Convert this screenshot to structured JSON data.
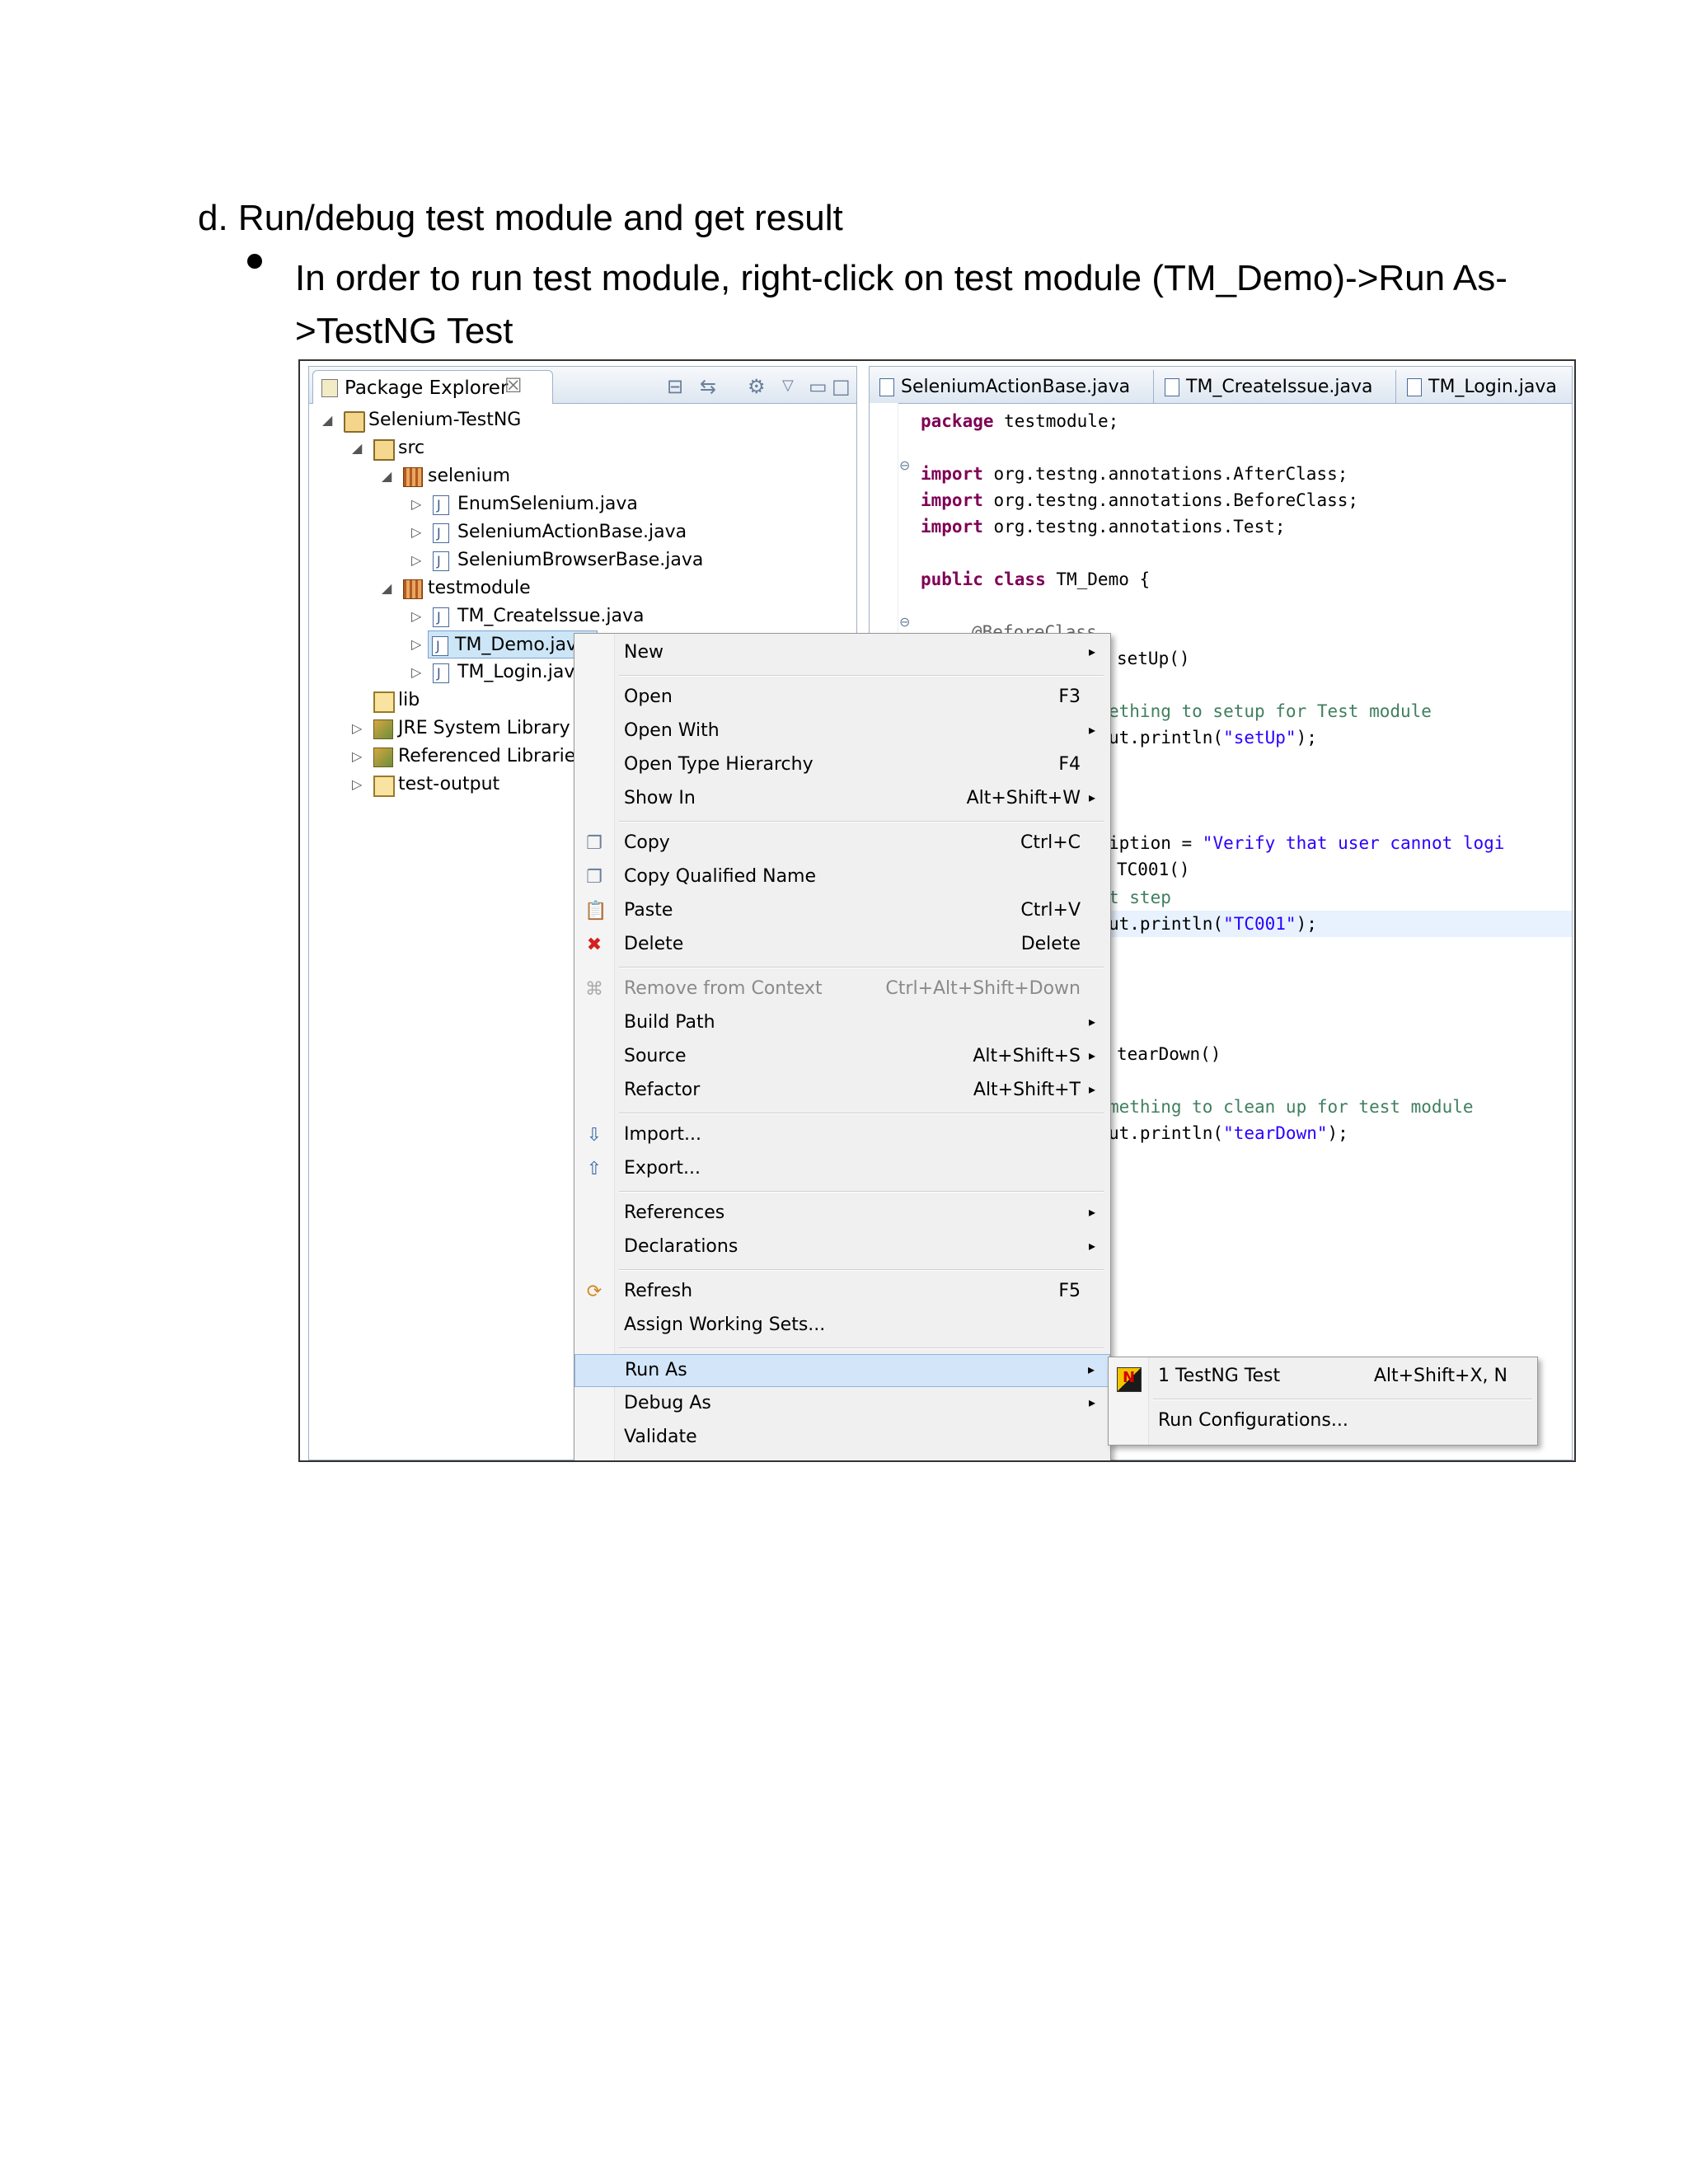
{
  "document": {
    "heading": "d.  Run/debug test module and get result",
    "bullet": "In order to run test module, right-click on test module (TM_Demo)->Run As->TestNG Test"
  },
  "package_explorer": {
    "title": "Package Explorer",
    "close_glyph": "☒",
    "tree": [
      {
        "label": "Selenium-TestNG"
      },
      {
        "label": "src"
      },
      {
        "label": "selenium"
      },
      {
        "label": "EnumSelenium.java"
      },
      {
        "label": "SeleniumActionBase.java"
      },
      {
        "label": "SeleniumBrowserBase.java"
      },
      {
        "label": "testmodule"
      },
      {
        "label": "TM_CreateIssue.java"
      },
      {
        "label": "TM_Demo.java"
      },
      {
        "label": "TM_Login.java"
      },
      {
        "label": "lib"
      },
      {
        "label": "JRE System Library [J"
      },
      {
        "label": "Referenced Libraries"
      },
      {
        "label": "test-output"
      }
    ]
  },
  "editor": {
    "tabs": [
      "SeleniumActionBase.java",
      "TM_CreateIssue.java",
      "TM_Login.java"
    ],
    "code": {
      "l1_kw": "package",
      "l1_rest": " testmodule;",
      "imp_kw": "import",
      "imp1": " org.testng.annotations.AfterClass;",
      "imp2": " org.testng.annotations.BeforeClass;",
      "imp3": " org.testng.annotations.Test;",
      "class_kw": "public class",
      "class_rest": " TM_Demo {",
      "ann_before": "@BeforeClass",
      "setup": "setUp()",
      "cm_setup": "ething to setup for Test module",
      "print_setup_pre": "ut.println(",
      "print_setup_str": "\"setUp\"",
      "print_end": ");",
      "desc_pre": "iption = ",
      "desc_str": "\"Verify that user cannot logi",
      "tc001": "TC001()",
      "cm_step": "t step",
      "print_tc_pre": "ut.println(",
      "print_tc_str": "\"TC001\"",
      "teardown": "tearDown()",
      "cm_clean": "mething to clean up for test module",
      "print_td_pre": "ut.println(",
      "print_td_str": "\"tearDown\""
    }
  },
  "context_menu": {
    "items": [
      {
        "label": "New",
        "shortcut": "",
        "arrow": "▸"
      },
      {
        "label": "Open",
        "shortcut": "F3"
      },
      {
        "label": "Open With",
        "shortcut": "",
        "arrow": "▸"
      },
      {
        "label": "Open Type Hierarchy",
        "shortcut": "F4"
      },
      {
        "label": "Show In",
        "shortcut": "Alt+Shift+W",
        "arrow": "▸"
      },
      {
        "label": "Copy",
        "shortcut": "Ctrl+C"
      },
      {
        "label": "Copy Qualified Name",
        "shortcut": ""
      },
      {
        "label": "Paste",
        "shortcut": "Ctrl+V"
      },
      {
        "label": "Delete",
        "shortcut": "Delete"
      },
      {
        "label": "Remove from Context",
        "shortcut": "Ctrl+Alt+Shift+Down"
      },
      {
        "label": "Build Path",
        "shortcut": "",
        "arrow": "▸"
      },
      {
        "label": "Source",
        "shortcut": "Alt+Shift+S",
        "arrow": "▸"
      },
      {
        "label": "Refactor",
        "shortcut": "Alt+Shift+T",
        "arrow": "▸"
      },
      {
        "label": "Import...",
        "shortcut": ""
      },
      {
        "label": "Export...",
        "shortcut": ""
      },
      {
        "label": "References",
        "shortcut": "",
        "arrow": "▸"
      },
      {
        "label": "Declarations",
        "shortcut": "",
        "arrow": "▸"
      },
      {
        "label": "Refresh",
        "shortcut": "F5"
      },
      {
        "label": "Assign Working Sets...",
        "shortcut": ""
      },
      {
        "label": "Run As",
        "shortcut": "",
        "arrow": "▸"
      },
      {
        "label": "Debug As",
        "shortcut": "",
        "arrow": "▸"
      },
      {
        "label": "Validate",
        "shortcut": ""
      }
    ]
  },
  "submenu": {
    "items": [
      {
        "label": "1 TestNG Test",
        "shortcut": "Alt+Shift+X, N"
      },
      {
        "label": "Run Configurations...",
        "shortcut": ""
      }
    ]
  },
  "colors": {
    "keyword": "#7f0055",
    "string": "#2a00ff",
    "comment": "#3f7f5f",
    "menu_highlight": "#d3e5f8"
  }
}
